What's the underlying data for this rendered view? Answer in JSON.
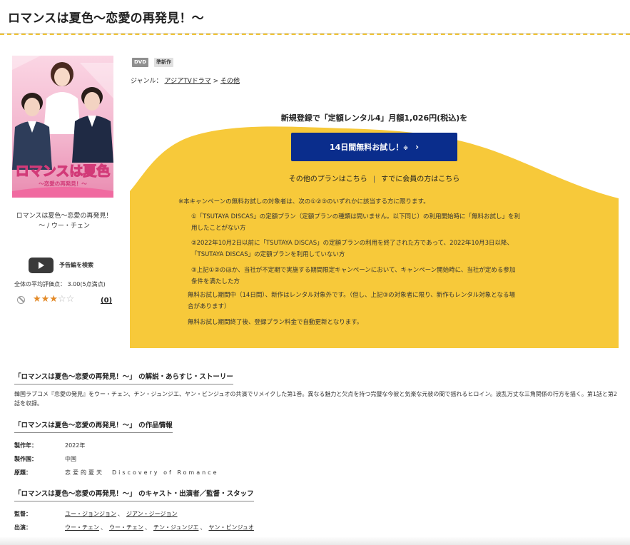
{
  "page": {
    "title": "ロマンスは夏色〜恋愛の再発見！〜"
  },
  "product": {
    "cover_art_text": "ロマンスは夏色",
    "cover_art_subtext": "〜恋愛の再発見！〜",
    "caption_line1": "ロマンスは夏色〜恋愛の再発見！",
    "caption_line2": "〜 / ウー・チェン",
    "trailer_label": "予告編を検索",
    "average_rating_text": "全体の平均評価点： 3.00(5点満点)",
    "rating_stars": 3,
    "rating_max": 5,
    "review_count": "(0)",
    "badges": [
      "DVD",
      "準新作"
    ],
    "genre_prefix": "ジャンル：",
    "genre_1": "アジアTVドラマ",
    "genre_separator": ">",
    "genre_2": "その他"
  },
  "campaign": {
    "headline": "新規登録で「定額レンタル4」月額1,026円(税込)を",
    "trial_button_label": "14日間無料お試し！",
    "trial_button_mark": "※",
    "other_plans_link": "その他のプランはこちら",
    "separator": "|",
    "member_link": "すでに会員の方はこちら",
    "accent_color": "#f7c93a",
    "button_color": "#0a2d8c",
    "notes": {
      "intro": "※本キャンペーンの無料お試しの対象者は、次の①②③のいずれかに該当する方に限ります。",
      "cond1_line1": "①「TSUTAYA DISCAS」の定額プラン（定額プランの種類は問いません。以下同じ）の利用開始時に「無料お試し」を利",
      "cond1_line2": "用したことがない方",
      "cond2_line1": "②2022年10月2日以前に「TSUTAYA DISCAS」の定額プランの利用を終了された方であって、2022年10月3日以降、",
      "cond2_line2": "「TSUTAYA DISCAS」の定額プランを利用していない方",
      "cond3_line1": "③上記①②のほか、当社が不定期で実施する期間限定キャンペーンにおいて、キャンペーン開始時に、当社が定める参加",
      "cond3_line2": "条件を満たした方",
      "period_line1": "無料お試し期間中（14日間）、新作はレンタル対象外です。（但し、上記③の対象者に限り、新作もレンタル対象となる場",
      "period_line2": "合があります）",
      "after": "無料お試し期間終了後、登録プラン料金で自動更新となります。"
    }
  },
  "synopsis": {
    "heading": "「ロマンスは夏色〜恋愛の再発見！〜」 の解説・あらすじ・ストーリー",
    "text": "韓国ラブコメ『恋愛の発見』をウー・チェン、チン・ジュンジエ、ヤン・ビンジュオの共演でリメイクした第1巻。異なる魅力と欠点を持つ完璧な今彼と気楽な元彼の間で揺れるヒロイン。波乱万丈な三角関係の行方を描く。第1話と第2話を収録。"
  },
  "work_info": {
    "heading": "「ロマンスは夏色〜恋愛の再発見！〜」 の作品情報",
    "rows": [
      {
        "label": "製作年：",
        "value": "2022年"
      },
      {
        "label": "製作国：",
        "value": "中国"
      },
      {
        "label": "原題：",
        "value": "恋爱的夏天　Discovery of Romance"
      }
    ]
  },
  "cast": {
    "heading": "「ロマンスは夏色〜恋愛の再発見！〜」 のキャスト・出演者／監督・スタッフ",
    "director_label": "監督：",
    "directors": [
      "ユー・ジョンジョン",
      "ジアン・ジージョン"
    ],
    "cast_label": "出演：",
    "actors": [
      "ウー・チェン",
      "ウー・チェン",
      "チン・ジュンジエ",
      "ヤン・ビンジュオ"
    ],
    "comma": "、"
  }
}
